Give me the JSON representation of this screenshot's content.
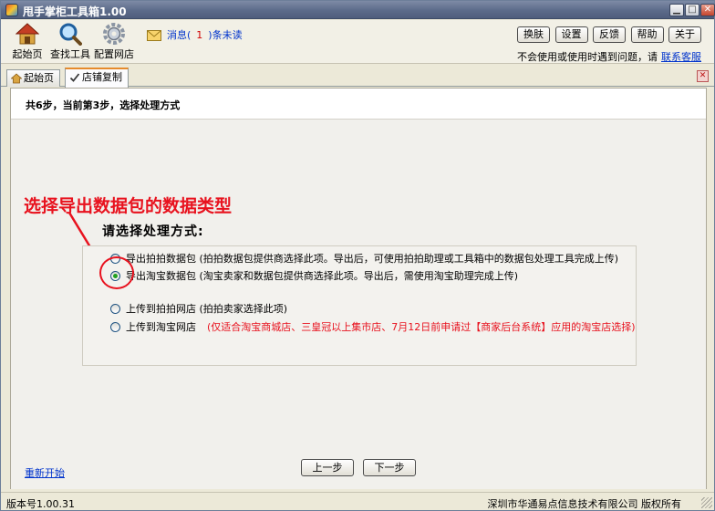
{
  "window": {
    "title": "甩手掌柜工具箱1.00"
  },
  "toolbar": {
    "home_label": "起始页",
    "search_label": "查找工具",
    "config_label": "配置网店",
    "message_prefix": "消息(",
    "message_count": "1",
    "message_suffix": ")条未读",
    "buttons": [
      "换肤",
      "设置",
      "反馈",
      "帮助",
      "关于"
    ],
    "help_text": "不会使用或使用时遇到问题，请",
    "help_link": "联系客服"
  },
  "tabs": [
    {
      "label": "起始页"
    },
    {
      "label": "店铺复制"
    }
  ],
  "step": {
    "text": "共6步，当前第3步，选择处理方式"
  },
  "annotation": {
    "text": "选择导出数据包的数据类型"
  },
  "choose": {
    "title": "请选择处理方式:",
    "options": [
      {
        "label": "导出拍拍数据包 (拍拍数据包提供商选择此项。导出后，可使用拍拍助理或工具箱中的数据包处理工具完成上传)",
        "note": "",
        "selected": false
      },
      {
        "label": "导出淘宝数据包 (淘宝卖家和数据包提供商选择此项。导出后，需使用淘宝助理完成上传)",
        "note": "",
        "selected": true
      },
      {
        "label": "上传到拍拍网店 (拍拍卖家选择此项)",
        "note": "",
        "selected": false
      },
      {
        "label": "上传到淘宝网店",
        "note": "(仅适合淘宝商城店、三皇冠以上集市店、7月12日前申请过【商家后台系统】应用的淘宝店选择)",
        "selected": false
      }
    ]
  },
  "nav": {
    "restart": "重新开始",
    "prev": "上一步",
    "next": "下一步"
  },
  "status": {
    "version": "版本号1.00.31",
    "copyright": "深圳市华通易点信息技术有限公司 版权所有"
  },
  "colors": {
    "annotation": "#e8121e",
    "link": "#0033cc",
    "tab_accent": "#e68b2c"
  }
}
